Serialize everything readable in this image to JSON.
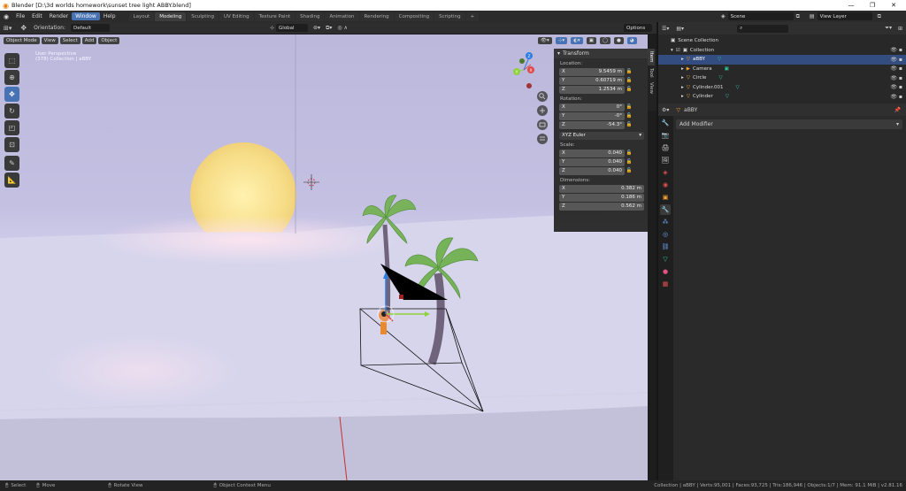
{
  "window": {
    "title": "Blender [D:\\3d worlds homework\\sunset tree light ABBY.blend]",
    "min_glyph": "—",
    "max_glyph": "❐",
    "close_glyph": "✕"
  },
  "menu": [
    "File",
    "Edit",
    "Render",
    "Window",
    "Help"
  ],
  "menu_active_index": 3,
  "workspaces": [
    "Layout",
    "Modeling",
    "Sculpting",
    "UV Editing",
    "Texture Paint",
    "Shading",
    "Animation",
    "Rendering",
    "Compositing",
    "Scripting"
  ],
  "workspace_active": "Modeling",
  "workspace_add": "+",
  "scene": {
    "name": "Scene",
    "view_layer": "View Layer"
  },
  "viewport_header": {
    "orientation_label": "Orientation:",
    "orientation_value": "Default",
    "transform_space": "Global",
    "options_label": "Options"
  },
  "viewport_header2": {
    "mode": "Object Mode",
    "view": "View",
    "select": "Select",
    "add": "Add",
    "object": "Object"
  },
  "viewport": {
    "info_line1": "User Perspective",
    "info_line2": "(378) Collection | aBBY",
    "gizmo": {
      "x": "X",
      "y": "Y",
      "z": "Z"
    }
  },
  "npanel": {
    "title": "Transform",
    "location_label": "Location:",
    "location": [
      {
        "axis": "X",
        "value": "9.5459 m"
      },
      {
        "axis": "Y",
        "value": "0.60719 m"
      },
      {
        "axis": "Z",
        "value": "1.2534 m"
      }
    ],
    "rotation_label": "Rotation:",
    "rotation": [
      {
        "axis": "X",
        "value": "0°"
      },
      {
        "axis": "Y",
        "value": "-0°"
      },
      {
        "axis": "Z",
        "value": "-54.3°"
      }
    ],
    "rotation_mode": "XYZ Euler",
    "scale_label": "Scale:",
    "scale": [
      {
        "axis": "X",
        "value": "0.040"
      },
      {
        "axis": "Y",
        "value": "0.040"
      },
      {
        "axis": "Z",
        "value": "0.040"
      }
    ],
    "dimensions_label": "Dimensions:",
    "dimensions": [
      {
        "axis": "X",
        "value": "0.382 m"
      },
      {
        "axis": "Y",
        "value": "0.186 m"
      },
      {
        "axis": "Z",
        "value": "0.562 m"
      }
    ],
    "tabs": [
      "Item",
      "Tool",
      "View"
    ]
  },
  "outliner": {
    "rows": [
      {
        "label": "Scene Collection",
        "indent": 0
      },
      {
        "label": "Collection",
        "indent": 1
      },
      {
        "label": "aBBY",
        "indent": 2,
        "selected": true
      },
      {
        "label": "Camera",
        "indent": 2
      },
      {
        "label": "Circle",
        "indent": 2
      },
      {
        "label": "Cylinder.001",
        "indent": 2
      },
      {
        "label": "Cylinder",
        "indent": 2
      }
    ]
  },
  "properties": {
    "object_name": "aBBY",
    "add_modifier": "Add Modifier"
  },
  "statusbar": {
    "select": "Select",
    "move": "Move",
    "rotate": "Rotate View",
    "context": "Object Context Menu",
    "stats": "Collection | aBBY | Verts:95,001 | Faces:93,725 | Tris:186,946 | Objects:1/7 | Mem: 91.1 MiB | v2.81.16"
  },
  "colors": {
    "accent": "#4772b3",
    "sun": "#f8e08a",
    "palm_leaf": "#6fae4a",
    "trunk": "#7a6e86",
    "ocean": "#c0bde0"
  }
}
